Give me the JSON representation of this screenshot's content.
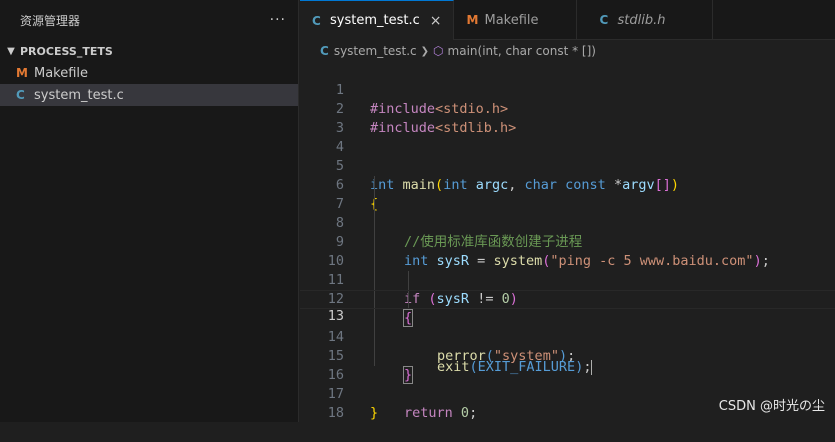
{
  "sidebar": {
    "title": "资源管理器",
    "more": "···",
    "folder": "PROCESS_TETS",
    "files": [
      {
        "icon": "M",
        "name": "Makefile"
      },
      {
        "icon": "C",
        "name": "system_test.c"
      }
    ]
  },
  "tabs": [
    {
      "icon": "C",
      "label": "system_test.c",
      "close": "×"
    },
    {
      "icon": "M",
      "label": "Makefile"
    },
    {
      "icon": "C",
      "label": "stdlib.h"
    }
  ],
  "breadcrumb": {
    "file_icon": "C",
    "file": "system_test.c",
    "symbol": "main(int, char const * [])"
  },
  "code": {
    "line_numbers": [
      "1",
      "2",
      "3",
      "4",
      "5",
      "6",
      "7",
      "8",
      "9",
      "10",
      "11",
      "12",
      "13",
      "14",
      "15",
      "16",
      "17",
      "18"
    ],
    "l1_directive": "#include",
    "l1_header": "<stdio.h>",
    "l2_directive": "#include",
    "l2_header": "<stdlib.h>",
    "l5_int": "int",
    "l5_main": "main",
    "l5_paren_open": "(",
    "l5_int2": "int",
    "l5_argc": "argc",
    "l5_comma": ", ",
    "l5_char": "char",
    "l5_const": "const",
    "l5_star": "*",
    "l5_argv": "argv",
    "l5_brackets": "[]",
    "l5_paren_close": ")",
    "l6_brace": "{",
    "l7_comment": "//使用标准库函数创建子进程",
    "l8_int": "int",
    "l8_sysR": "sysR",
    "l8_eq": " = ",
    "l8_system": "system",
    "l8_po": "(",
    "l8_str": "\"ping -c 5 www.baidu.com\"",
    "l8_pc": ")",
    "l8_semi": ";",
    "l10_if": "if",
    "l10_po": "(",
    "l10_sysR": "sysR",
    "l10_ne": " != ",
    "l10_zero": "0",
    "l10_pc": ")",
    "l11_brace": "{",
    "l12_perror": "perror",
    "l12_po": "(",
    "l12_str": "\"system\"",
    "l12_pc": ")",
    "l12_semi": ";",
    "l13_exit": "exit",
    "l13_po": "(",
    "l13_const": "EXIT_FAILURE",
    "l13_pc": ")",
    "l13_semi": ";",
    "l14_brace": "}",
    "l16_return": "return",
    "l16_zero": "0",
    "l16_semi": ";",
    "l17_brace": "}"
  },
  "watermark": "CSDN @时光の尘"
}
